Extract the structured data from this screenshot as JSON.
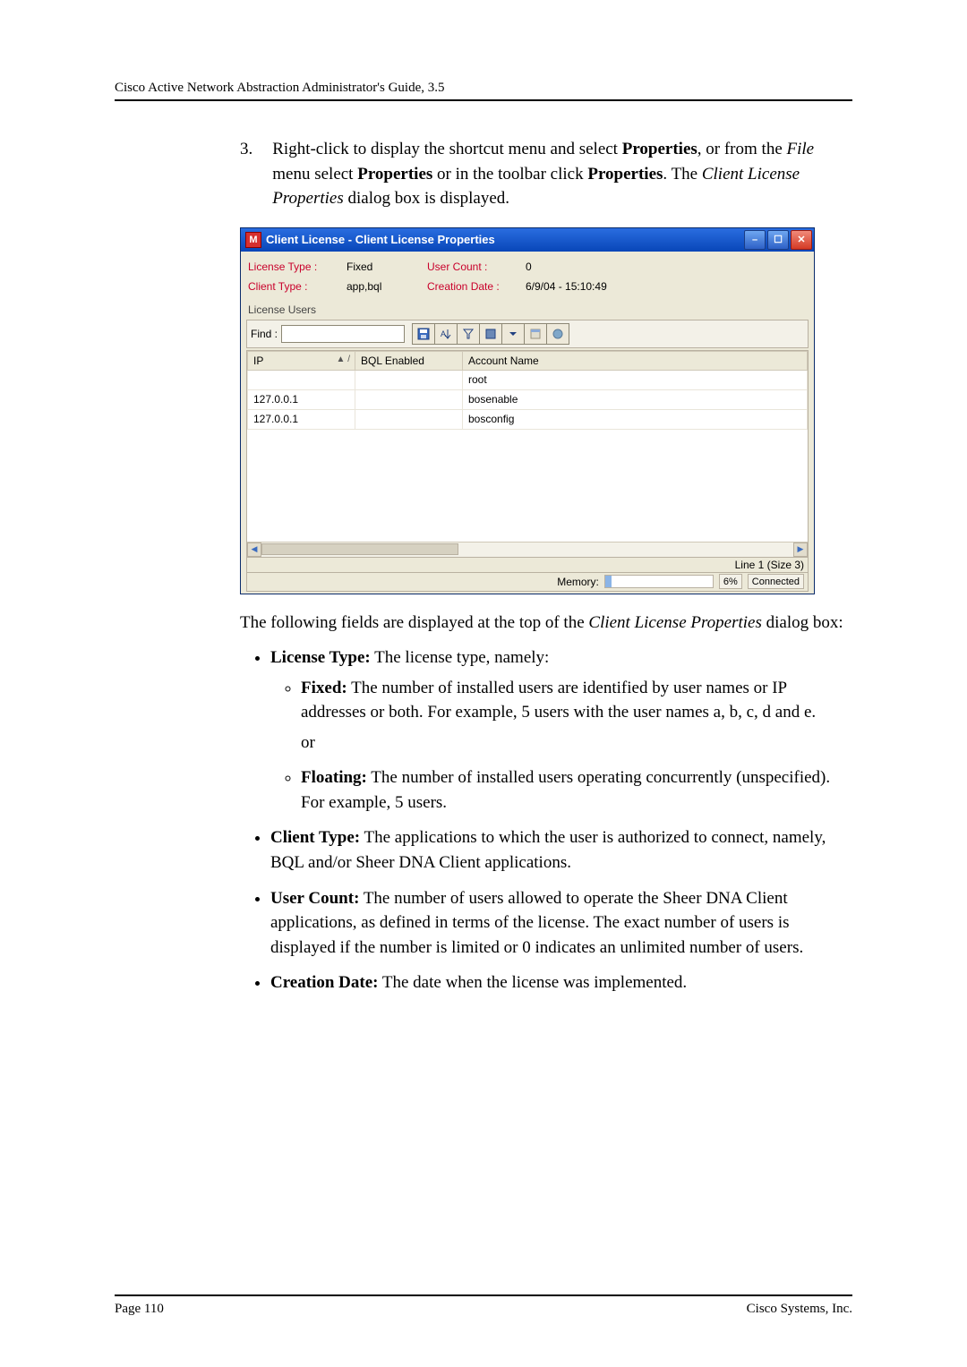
{
  "header": {
    "doc_title": "Cisco Active Network Abstraction Administrator's Guide, 3.5"
  },
  "step": {
    "number": "3.",
    "text_p1": "Right-click to display the shortcut menu and select ",
    "text_b1": "Properties",
    "text_p2": ", or from the ",
    "text_i1": "File",
    "text_p3": " menu select ",
    "text_b2": "Properties",
    "text_p4": " or in the toolbar click ",
    "text_b3": "Properties",
    "text_p5": ". The ",
    "text_i2": "Client License Properties",
    "text_p6": " dialog box is displayed."
  },
  "window": {
    "app_glyph": "M",
    "title": "Client License - Client License Properties",
    "fields": {
      "license_type_label": "License Type :",
      "license_type_value": "Fixed",
      "user_count_label": "User Count :",
      "user_count_value": "0",
      "client_type_label": "Client Type :",
      "client_type_value": "app,bql",
      "creation_date_label": "Creation Date :",
      "creation_date_value": "6/9/04 - 15:10:49"
    },
    "group_label": "License Users",
    "toolbar": {
      "find_label": "Find :",
      "find_value": ""
    },
    "table": {
      "columns": [
        "IP",
        "BQL Enabled",
        "Account Name"
      ],
      "sort_indicator": "▲ /",
      "rows": [
        {
          "ip": "",
          "bql": "",
          "acct": "root"
        },
        {
          "ip": "127.0.0.1",
          "bql": "",
          "acct": "bosenable"
        },
        {
          "ip": "127.0.0.1",
          "bql": "",
          "acct": "bosconfig"
        }
      ]
    },
    "line_counter": "Line 1 (Size 3)",
    "status": {
      "memory_label": "Memory:",
      "memory_pct": "6%",
      "connected": "Connected"
    }
  },
  "after": {
    "intro_p1": "The following fields are displayed at the top of the ",
    "intro_i1": "Client License Properties",
    "intro_p2": " dialog box:",
    "b_license_type": "License Type:",
    "t_license_type": " The license type, namely:",
    "b_fixed": "Fixed:",
    "t_fixed": " The number of installed users are identified by user names or IP addresses or both. For example, 5 users with the user names a, b, c, d and e.",
    "or": "or",
    "b_floating": "Floating:",
    "t_floating": " The number of installed users operating concurrently (unspecified). For example, 5 users.",
    "b_client_type": "Client Type:",
    "t_client_type": " The applications to which the user is authorized to connect, namely, BQL and/or Sheer DNA Client applications.",
    "b_user_count": "User Count:",
    "t_user_count": " The number of users allowed to operate the Sheer DNA Client applications, as defined in terms of the license. The exact number of users is displayed if the number is limited or 0 indicates an unlimited number of users.",
    "b_creation_date": "Creation Date:",
    "t_creation_date": " The date when the license was implemented."
  },
  "footer": {
    "left": "Page 110",
    "right": "Cisco Systems, Inc."
  }
}
